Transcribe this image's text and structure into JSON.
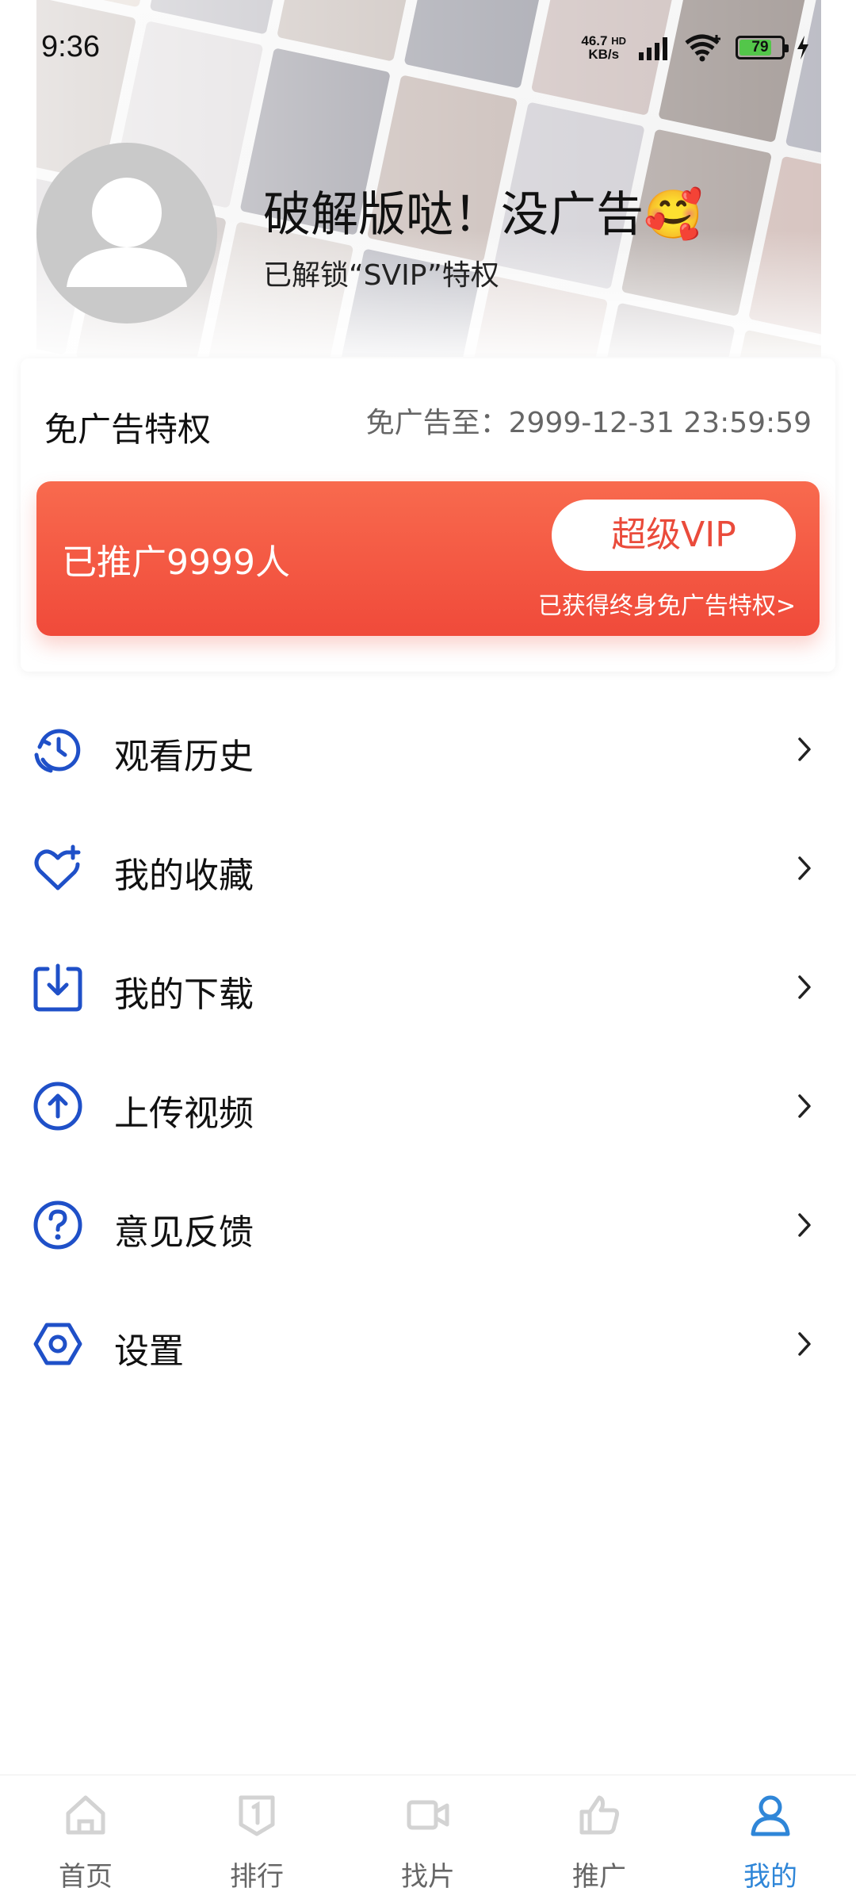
{
  "status_bar": {
    "time": "9:36",
    "net_speed_value": "46.7",
    "net_speed_unit": "KB/s",
    "hd_label": "HD",
    "battery_level": "79",
    "battery_fraction": 0.79,
    "battery_color": "#53c64a"
  },
  "profile": {
    "title": "破解版哒！没广告🥰",
    "subtitle": "已解锁“SVIP”特权"
  },
  "vip_panel": {
    "title": "免广告特权",
    "expire_text": "免广告至：2999-12-31 23:59:59",
    "invite_text": "已推广9999人",
    "vip_button_label": "超级VIP",
    "lifetime_text": "已获得终身免广告特权>",
    "accent_color": "#f04a3a"
  },
  "menu": {
    "items": [
      {
        "label": "观看历史",
        "icon": "history-icon"
      },
      {
        "label": "我的收藏",
        "icon": "favorite-heart-icon"
      },
      {
        "label": "我的下载",
        "icon": "download-icon"
      },
      {
        "label": "上传视频",
        "icon": "upload-icon"
      },
      {
        "label": "意见反馈",
        "icon": "feedback-question-icon"
      },
      {
        "label": "设置",
        "icon": "settings-hexagon-icon"
      }
    ],
    "icon_color": "#1f50c8"
  },
  "bottom_nav": {
    "items": [
      {
        "label": "首页",
        "icon": "home-icon"
      },
      {
        "label": "排行",
        "icon": "ranking-icon"
      },
      {
        "label": "找片",
        "icon": "video-camera-icon"
      },
      {
        "label": "推广",
        "icon": "thumbs-up-icon"
      },
      {
        "label": "我的",
        "icon": "user-icon",
        "active": true
      }
    ],
    "active_color": "#2f86d8",
    "inactive_color": "#d3d3d3"
  }
}
